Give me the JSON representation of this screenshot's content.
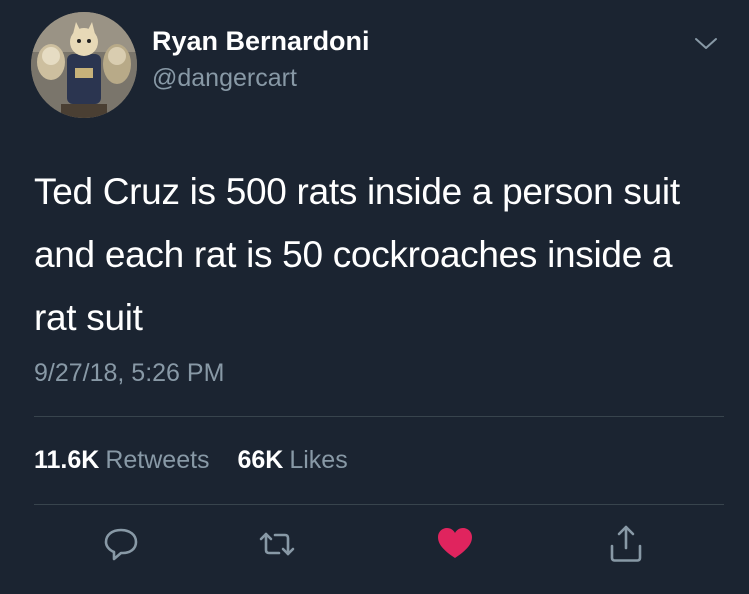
{
  "user": {
    "display_name": "Ryan Bernardoni",
    "handle": "@dangercart",
    "avatar_icon": "avatar-photo"
  },
  "tweet": {
    "text": "Ted Cruz is 500 rats inside a person suit and each rat is 50 cockroaches inside a rat suit",
    "timestamp": "9/27/18, 5:26 PM"
  },
  "stats": {
    "retweets_count": "11.6K",
    "retweets_label": "Retweets",
    "likes_count": "66K",
    "likes_label": "Likes"
  },
  "actions": [
    {
      "name": "reply",
      "icon": "speech-bubble-icon"
    },
    {
      "name": "retweet",
      "icon": "retweet-arrows-icon"
    },
    {
      "name": "like",
      "icon": "heart-icon",
      "liked": true
    },
    {
      "name": "share",
      "icon": "share-icon"
    }
  ],
  "menu_icon": "chevron-down-icon",
  "colors": {
    "background": "#1b2431",
    "primary_text": "#ffffff",
    "secondary_text": "#8899a6",
    "divider": "#38444d",
    "like_active": "#e0245e"
  }
}
